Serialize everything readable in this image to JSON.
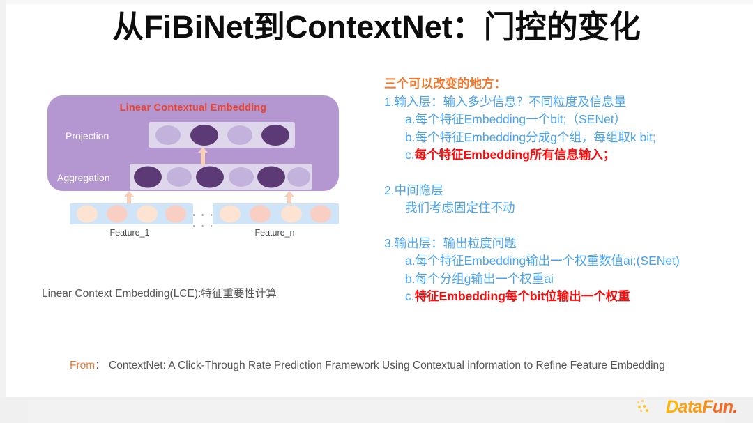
{
  "slide": {
    "title": "从FiBiNet到ContextNet：门控的变化"
  },
  "diagram": {
    "box_title": "Linear Contextual Embedding",
    "rows": [
      {
        "label": "Projection",
        "dots": [
          "light",
          "dark",
          "light",
          "dark"
        ]
      },
      {
        "label": "Aggregation",
        "dots": [
          "dark",
          "light",
          "dark",
          "light",
          "dark",
          "light"
        ]
      }
    ],
    "feature_boxes": [
      {
        "label": "Feature_1",
        "dots": [
          "a",
          "b",
          "a",
          "b"
        ]
      },
      {
        "label": "Feature_n",
        "dots": [
          "a",
          "b",
          "a",
          "b"
        ]
      }
    ],
    "ellipsis": "· · · · · ·",
    "caption": "Linear Context Embedding(LCE):特征重要性计算",
    "colors": {
      "container": "#b497d1",
      "track": "#ded7ec",
      "dot_dark": "#5b3a75",
      "dot_light": "#c2b2dc",
      "feature_box": "#cfe4f7",
      "feature_dot_a": "#fde3d2",
      "feature_dot_b": "#f9cfc4",
      "arrow": "#f8cfb9",
      "box_title": "#f0422a"
    }
  },
  "notes": {
    "heading": "三个可以改变的地方：",
    "lines": [
      {
        "text": "1.输入层：输入多少信息？不同粒度及信息量",
        "color": "blue",
        "indent": 1
      },
      {
        "text": "a.每个特征Embedding一个bit;（SENet）",
        "color": "blue",
        "indent": 2
      },
      {
        "text": "b.每个特征Embedding分成g个组，每组取k bit;",
        "color": "blue",
        "indent": 2
      }
    ],
    "line_1c_prefix": "c.",
    "line_1c_body": "每个特征Embedding所有信息输入；",
    "section2_title": "2.中间隐层",
    "section2_body": "我们考虑固定住不动",
    "section3_title": "3.输出层：输出粒度问题",
    "section3_a": "a.每个特征Embedding输出一个权重数值ai;(SENet)",
    "section3_b": "b.每个分组g输出一个权重ai",
    "line_3c_prefix": "c.",
    "line_3c_body": "特征Embedding每个bit位输出一个权重",
    "colors": {
      "heading": "#f0772c",
      "blue": "#4aa3f0",
      "red": "#fb0b0b"
    }
  },
  "citation": {
    "keyword": "From",
    "separator": "：",
    "text": "ContextNet: A Click-Through Rate Prediction Framework Using Contextual information to Refine Feature Embedding"
  },
  "logo": {
    "part1": "D",
    "part2": "ata",
    "part3": "F",
    "part4": "un",
    "part5": ".",
    "colors": {
      "yellow": "#ffc20e",
      "orange": "#f9681d"
    }
  }
}
